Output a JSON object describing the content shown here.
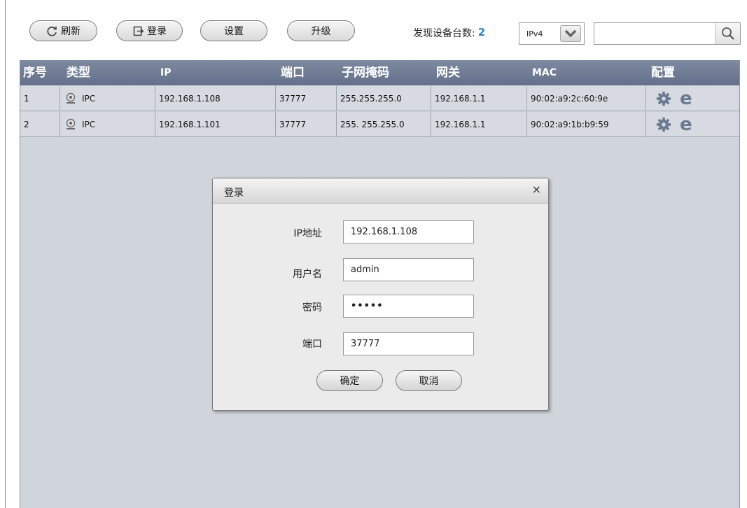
{
  "toolbar": {
    "refresh_label": "刷新",
    "login_label": "登录",
    "settings_label": "设置",
    "upgrade_label": "升级",
    "found_label": "发现设备台数:",
    "found_count": "2",
    "ip_version": "IPv4",
    "search_value": ""
  },
  "table": {
    "headers": [
      "序号",
      "类型",
      "IP",
      "端口",
      "子网掩码",
      "网关",
      "MAC",
      "配置"
    ],
    "rows": [
      {
        "index": "1",
        "type": "IPC",
        "ip": "192.168.1.108",
        "port": "37777",
        "mask": "255.255.255.0",
        "gateway": "192.168.1.1",
        "mac": "90:02:a9:2c:60:9e"
      },
      {
        "index": "2",
        "type": "IPC",
        "ip": "192.168.1.101",
        "port": "37777",
        "mask": "255. 255.255.0",
        "gateway": "192.168.1.1",
        "mac": "90:02:a9:1b:b9:59"
      }
    ]
  },
  "dialog": {
    "title": "登录",
    "close": "×",
    "ip_label": "IP地址",
    "ip_value": "192.168.1.108",
    "user_label": "用户名",
    "user_value": "admin",
    "password_label": "密码",
    "password_value": "•••••",
    "port_label": "端口",
    "port_value": "37777",
    "ok_label": "确定",
    "cancel_label": "取消"
  },
  "colors": {
    "header_bg": "#6f7b93",
    "grid_bg": "#d0d4db",
    "count": "#2a86c8"
  }
}
